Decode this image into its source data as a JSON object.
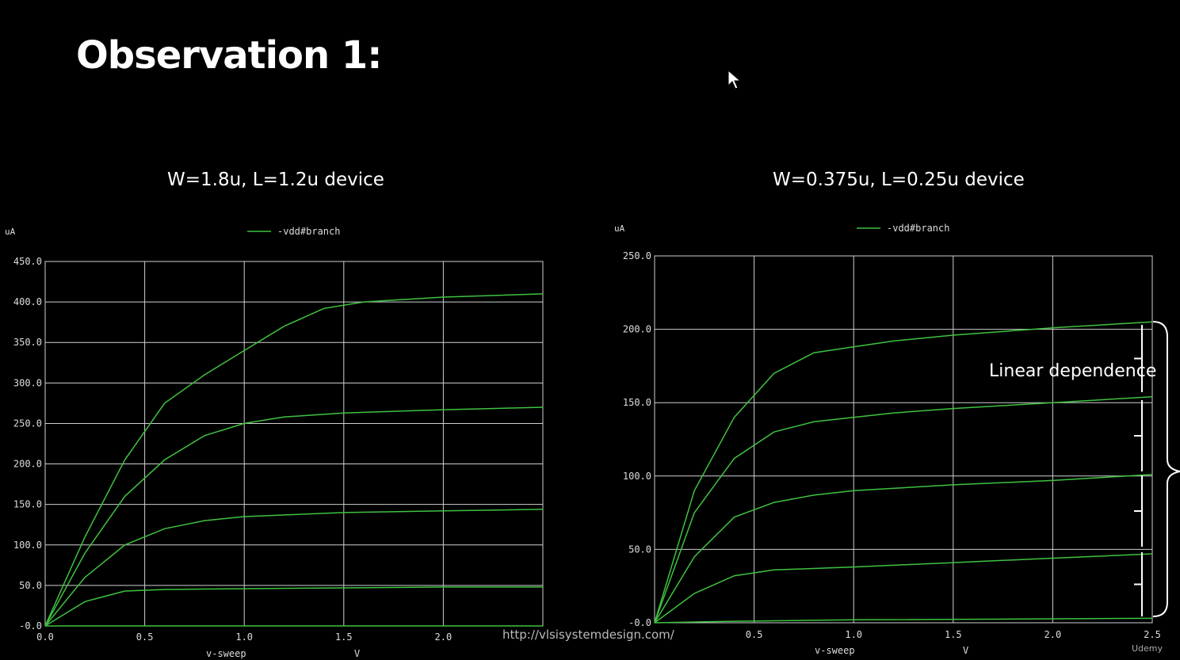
{
  "slide": {
    "title": "Observation 1:",
    "url": "http://vlsisystemdesign.com/",
    "brand": "Udemy",
    "annotation": "Linear dependence"
  },
  "colors": {
    "background": "#000000",
    "grid": "#ffffff",
    "trace": "#3fc23f",
    "text": "#ffffff"
  },
  "chart_data": [
    {
      "type": "line",
      "title": "W=1.8u, L=1.2u device",
      "ylabel": "uA",
      "xlabel": "v-sweep",
      "xunit": "V",
      "legend": [
        "-vdd#branch"
      ],
      "legend_position": "top-center",
      "grid": true,
      "xlim": [
        0,
        2.5
      ],
      "ylim": [
        0,
        450
      ],
      "xticks": [
        "0.0",
        "0.5",
        "1.0",
        "1.5",
        "2.0"
      ],
      "yticks": [
        "-0.0",
        "50.0",
        "100.0",
        "150.0",
        "200.0",
        "250.0",
        "300.0",
        "350.0",
        "400.0",
        "450.0"
      ],
      "series": [
        {
          "x": [
            0,
            0.2,
            0.4,
            0.6,
            0.8,
            1.0,
            1.2,
            1.4,
            1.6,
            2.0,
            2.5
          ],
          "y": [
            0,
            110,
            205,
            275,
            310,
            340,
            370,
            392,
            400,
            406,
            410
          ]
        },
        {
          "x": [
            0,
            0.2,
            0.4,
            0.6,
            0.8,
            1.0,
            1.2,
            1.5,
            2.0,
            2.5
          ],
          "y": [
            0,
            90,
            160,
            205,
            235,
            250,
            258,
            263,
            267,
            270
          ]
        },
        {
          "x": [
            0,
            0.2,
            0.4,
            0.6,
            0.8,
            1.0,
            1.5,
            2.0,
            2.5
          ],
          "y": [
            0,
            60,
            100,
            120,
            130,
            135,
            140,
            142,
            144
          ]
        },
        {
          "x": [
            0,
            0.2,
            0.4,
            0.6,
            1.0,
            1.5,
            2.0,
            2.5
          ],
          "y": [
            0,
            30,
            43,
            45,
            46,
            47,
            48,
            48
          ]
        },
        {
          "x": [
            0,
            2.5
          ],
          "y": [
            0,
            0
          ]
        }
      ]
    },
    {
      "type": "line",
      "title": "W=0.375u, L=0.25u device",
      "ylabel": "uA",
      "xlabel": "v-sweep",
      "xunit": "V",
      "legend": [
        "-vdd#branch"
      ],
      "legend_position": "top-center",
      "grid": true,
      "xlim": [
        0,
        2.5
      ],
      "ylim": [
        0,
        250
      ],
      "xticks": [
        "0.5",
        "1.0",
        "1.5",
        "2.0",
        "2.5"
      ],
      "yticks": [
        "-0.0",
        "50.0",
        "100.0",
        "150.0",
        "200.0",
        "250.0"
      ],
      "series": [
        {
          "x": [
            0,
            0.2,
            0.4,
            0.6,
            0.8,
            1.0,
            1.2,
            1.5,
            2.0,
            2.5
          ],
          "y": [
            0,
            90,
            140,
            170,
            184,
            188,
            192,
            196,
            201,
            205
          ]
        },
        {
          "x": [
            0,
            0.2,
            0.4,
            0.6,
            0.8,
            1.0,
            1.2,
            1.5,
            2.0,
            2.5
          ],
          "y": [
            0,
            75,
            112,
            130,
            137,
            140,
            143,
            146,
            150,
            154
          ]
        },
        {
          "x": [
            0,
            0.2,
            0.4,
            0.6,
            0.8,
            1.0,
            1.5,
            2.0,
            2.5
          ],
          "y": [
            0,
            45,
            72,
            82,
            87,
            90,
            94,
            97,
            101
          ]
        },
        {
          "x": [
            0,
            0.2,
            0.4,
            0.6,
            1.0,
            1.5,
            2.0,
            2.5
          ],
          "y": [
            0,
            20,
            32,
            36,
            38,
            41,
            44,
            47
          ]
        },
        {
          "x": [
            0,
            0.4,
            1.0,
            2.5
          ],
          "y": [
            0,
            1,
            2,
            3
          ]
        }
      ]
    }
  ]
}
